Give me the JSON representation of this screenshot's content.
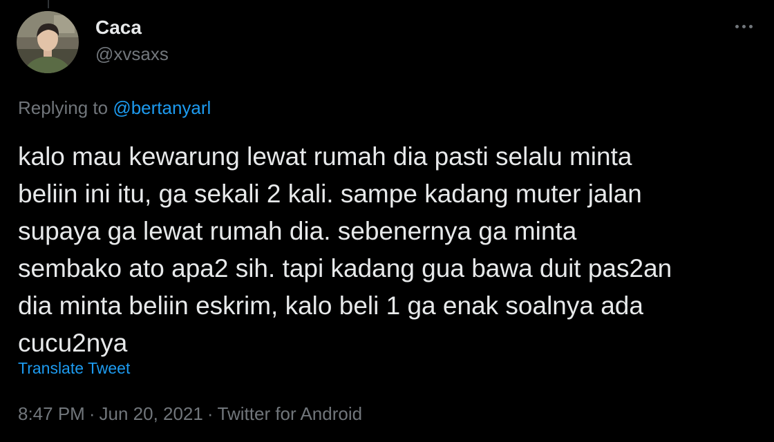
{
  "tweet": {
    "author": {
      "name": "Caca",
      "handle": "@xvsaxs"
    },
    "more_icon": "more-horizontal-icon",
    "replying": {
      "prefix": "Replying to",
      "mention": "@bertanyarl"
    },
    "text": "kalo mau kewarung lewat rumah dia pasti selalu minta\nbeliin ini itu, ga sekali 2 kali. sampe kadang muter jalan\nsupaya ga lewat rumah dia. sebenernya ga minta\nsembako ato apa2 sih. tapi kadang gua bawa duit pas2an\ndia minta beliin eskrim, kalo beli 1 ga enak soalnya ada\ncucu2nya",
    "translate_label": "Translate Tweet",
    "meta": {
      "time": "8:47 PM",
      "separator": "·",
      "date": "Jun 20, 2021",
      "source": "Twitter for Android"
    }
  },
  "colors": {
    "background": "#000000",
    "primary_text": "#e7e9ea",
    "secondary_text": "#71767b",
    "accent": "#1d9bf0"
  }
}
